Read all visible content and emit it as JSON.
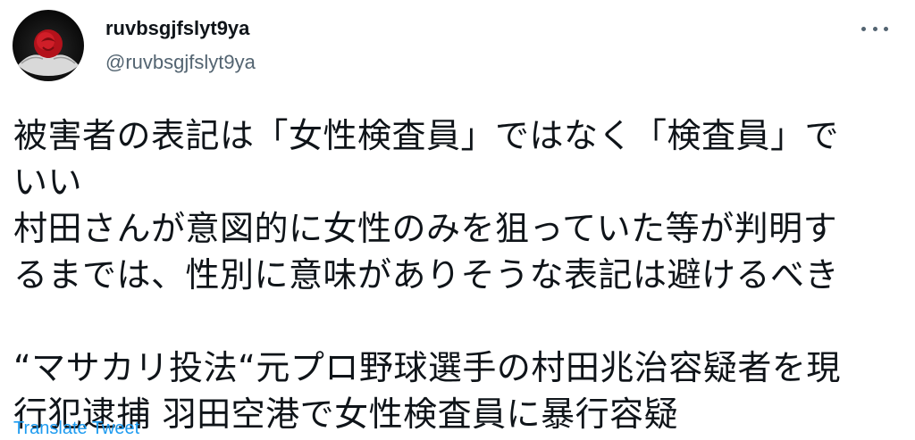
{
  "user": {
    "display_name": "ruvbsgjfslyt9ya",
    "handle": "@ruvbsgjfslyt9ya",
    "avatar_icon": "rose-in-hands-avatar"
  },
  "actions": {
    "more_icon": "more-horizontal-icon"
  },
  "tweet": {
    "lines": [
      "被害者の表記は「女性検査員」ではなく「検査員」で",
      "いい",
      "村田さんが意図的に女性のみを狙っていた等が判明す",
      "るまでは、性別に意味がありそうな表記は避けるべき",
      "",
      "“マサカリ投法“元プロ野球選手の村田兆治容疑者を現",
      "行犯逮捕 羽田空港で女性検査員に暴行容疑"
    ]
  },
  "translate": {
    "label": "Translate Tweet"
  },
  "colors": {
    "text": "#0f1419",
    "secondary": "#536471",
    "link": "#1d9bf0"
  }
}
